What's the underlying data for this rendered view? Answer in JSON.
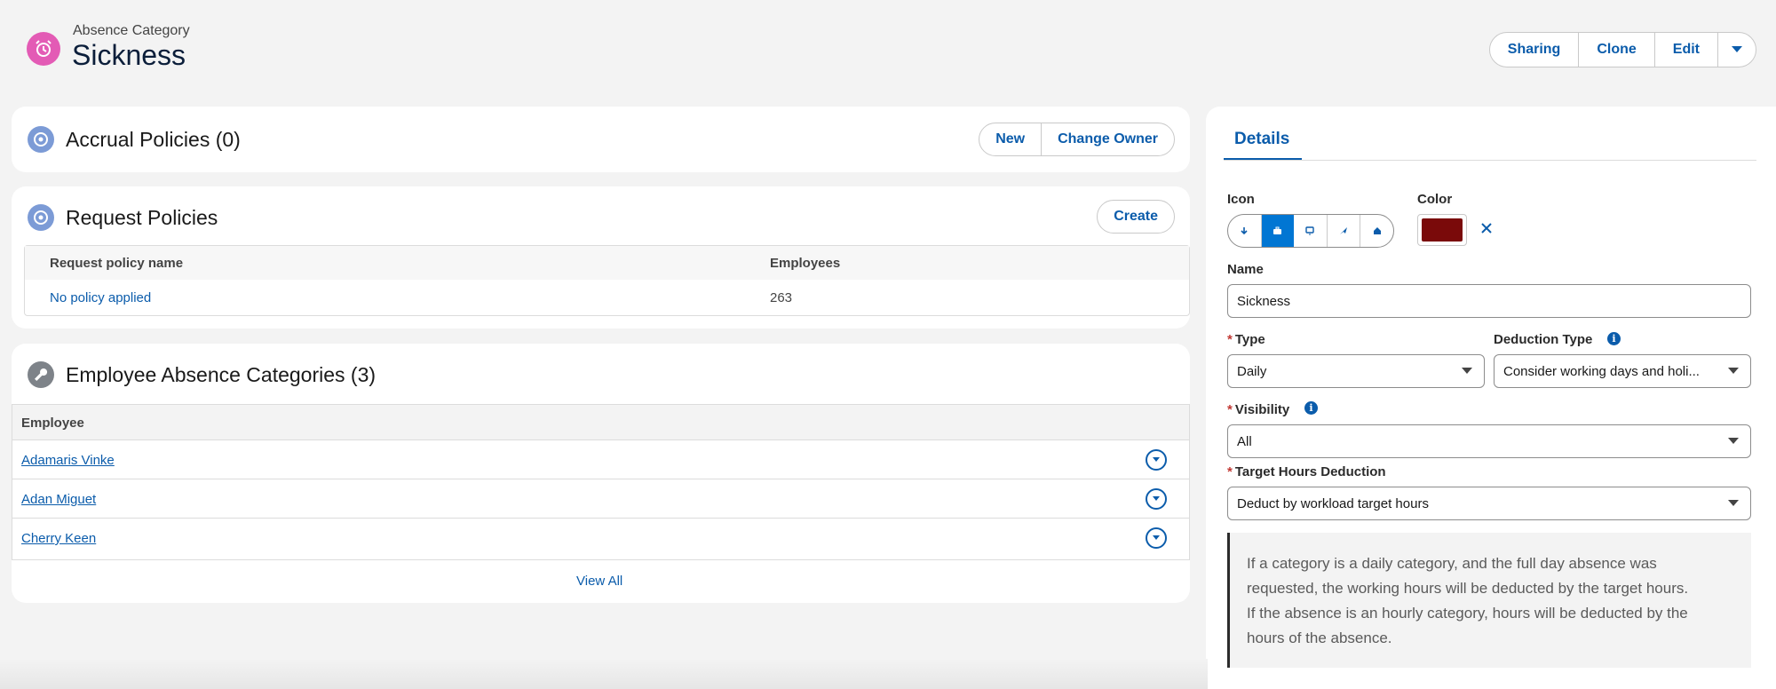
{
  "header": {
    "object_type": "Absence Category",
    "record_name": "Sickness",
    "actions": {
      "sharing": "Sharing",
      "clone": "Clone",
      "edit": "Edit"
    }
  },
  "accrual": {
    "title": "Accrual Policies (0)",
    "actions": {
      "new": "New",
      "change_owner": "Change Owner"
    }
  },
  "request": {
    "title": "Request Policies",
    "create": "Create",
    "columns": [
      "Request policy name",
      "Employees"
    ],
    "rows": [
      {
        "name": "No policy applied",
        "employees": "263"
      }
    ]
  },
  "employees": {
    "title": "Employee Absence Categories (3)",
    "column": "Employee",
    "rows": [
      "Adamaris Vinke",
      "Adan Miguet",
      "Cherry Keen"
    ],
    "view_all": "View All"
  },
  "details": {
    "tab": "Details",
    "icon_label": "Icon",
    "color_label": "Color",
    "color_value": "#7a0a0a",
    "accent": "#0b5cab",
    "name_label": "Name",
    "name_value": "Sickness",
    "type_label": "Type",
    "type_value": "Daily",
    "deduction_label": "Deduction Type",
    "deduction_value": "Consider working days and holi...",
    "visibility_label": "Visibility",
    "visibility_value": "All",
    "target_label": "Target Hours Deduction",
    "target_value": "Deduct by workload target hours",
    "help_text": "If a category is a daily category, and the full day absence was requested, the working hours will be deducted by the target hours. If the absence is an hourly category, hours will be deducted by the hours of the absence."
  }
}
